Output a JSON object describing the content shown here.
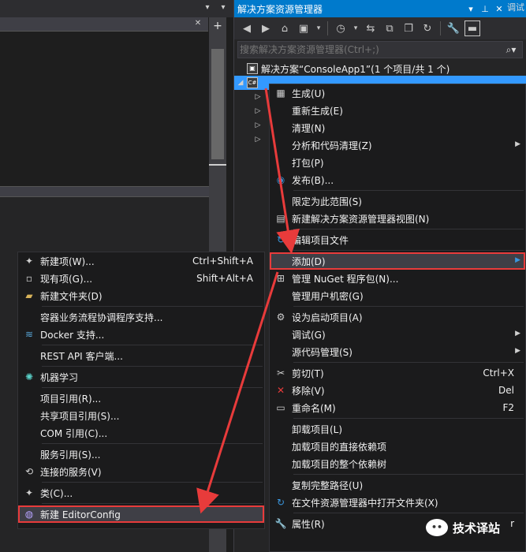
{
  "editor": {
    "top_btn_menu": "▾",
    "top_btn_pin": "▾",
    "top_btn_close": "✕",
    "plus": "+"
  },
  "solution_explorer": {
    "title": "解决方案资源管理器",
    "title_buttons": [
      "▾",
      "⊥",
      "✕"
    ],
    "search_placeholder": "搜索解决方案资源管理器(Ctrl+;)",
    "tree": {
      "solution_row": "解决方案“ConsoleApp1”(1 个项目/共 1 个)",
      "project_icon": "C#"
    },
    "right_vertical_tab": "调试"
  },
  "context_menu": {
    "items": [
      {
        "icon": "build-icon",
        "glyph": "▦",
        "label": "生成(U)"
      },
      {
        "label": "重新生成(E)"
      },
      {
        "label": "清理(N)"
      },
      {
        "label": "分析和代码清理(Z)",
        "submenu": true
      },
      {
        "label": "打包(P)"
      },
      {
        "icon": "publish-icon",
        "glyph": "◉",
        "label": "发布(B)..."
      },
      {
        "label": "限定为此范围(S)"
      },
      {
        "icon": "new-view-icon",
        "glyph": "▤",
        "label": "新建解决方案资源管理器视图(N)"
      },
      {
        "icon": "edit-project-icon",
        "glyph": "↻",
        "label": "编辑项目文件"
      },
      {
        "label": "添加(D)",
        "submenu": true,
        "highlighted": true
      },
      {
        "icon": "nuget-icon",
        "glyph": "⊞",
        "label": "管理 NuGet 程序包(N)..."
      },
      {
        "label": "管理用户机密(G)"
      },
      {
        "icon": "startup-gear-icon",
        "glyph": "⚙",
        "label": "设为启动项目(A)"
      },
      {
        "label": "调试(G)",
        "submenu": true
      },
      {
        "label": "源代码管理(S)",
        "submenu": true
      },
      {
        "icon": "cut-icon",
        "glyph": "✂",
        "label": "剪切(T)",
        "shortcut": "Ctrl+X"
      },
      {
        "icon": "remove-icon",
        "glyph": "✕",
        "label": "移除(V)",
        "shortcut": "Del"
      },
      {
        "icon": "rename-icon",
        "glyph": "▭",
        "label": "重命名(M)",
        "shortcut": "F2"
      },
      {
        "label": "卸载项目(L)"
      },
      {
        "label": "加载项目的直接依赖项"
      },
      {
        "label": "加载项目的整个依赖树"
      },
      {
        "label": "复制完整路径(U)"
      },
      {
        "icon": "open-folder-icon",
        "glyph": "↻",
        "label": "在文件资源管理器中打开文件夹(X)"
      },
      {
        "icon": "properties-icon",
        "glyph": "🔧",
        "label": "属性(R)",
        "shortcut": "r"
      }
    ]
  },
  "add_submenu": {
    "items": [
      {
        "icon": "new-item-icon",
        "glyph": "✦",
        "label": "新建项(W)...",
        "shortcut": "Ctrl+Shift+A"
      },
      {
        "icon": "existing-item-icon",
        "glyph": "▫",
        "label": "现有项(G)...",
        "shortcut": "Shift+Alt+A"
      },
      {
        "icon": "new-folder-icon",
        "glyph": "▰",
        "label": "新建文件夹(D)"
      },
      {
        "label": "容器业务流程协调程序支持..."
      },
      {
        "icon": "docker-icon",
        "glyph": "≋",
        "label": "Docker 支持..."
      },
      {
        "label": "REST API 客户端..."
      },
      {
        "icon": "ml-icon",
        "glyph": "✺",
        "label": "机器学习"
      },
      {
        "label": "项目引用(R)..."
      },
      {
        "label": "共享项目引用(S)..."
      },
      {
        "label": "COM 引用(C)..."
      },
      {
        "label": "服务引用(S)..."
      },
      {
        "icon": "connected-service-icon",
        "glyph": "⟲",
        "label": "连接的服务(V)"
      },
      {
        "icon": "class-icon",
        "glyph": "✦",
        "label": "类(C)..."
      },
      {
        "icon": "editorconfig-icon",
        "glyph": "◍",
        "label": "新建 EditorConfig",
        "highlighted": true
      }
    ]
  },
  "watermark": {
    "text": "技术译站",
    "icon": "wechat-icon"
  },
  "colors": {
    "accent": "#007acc",
    "annotation": "#e83b3b",
    "menu_bg": "#1b1b1c"
  }
}
